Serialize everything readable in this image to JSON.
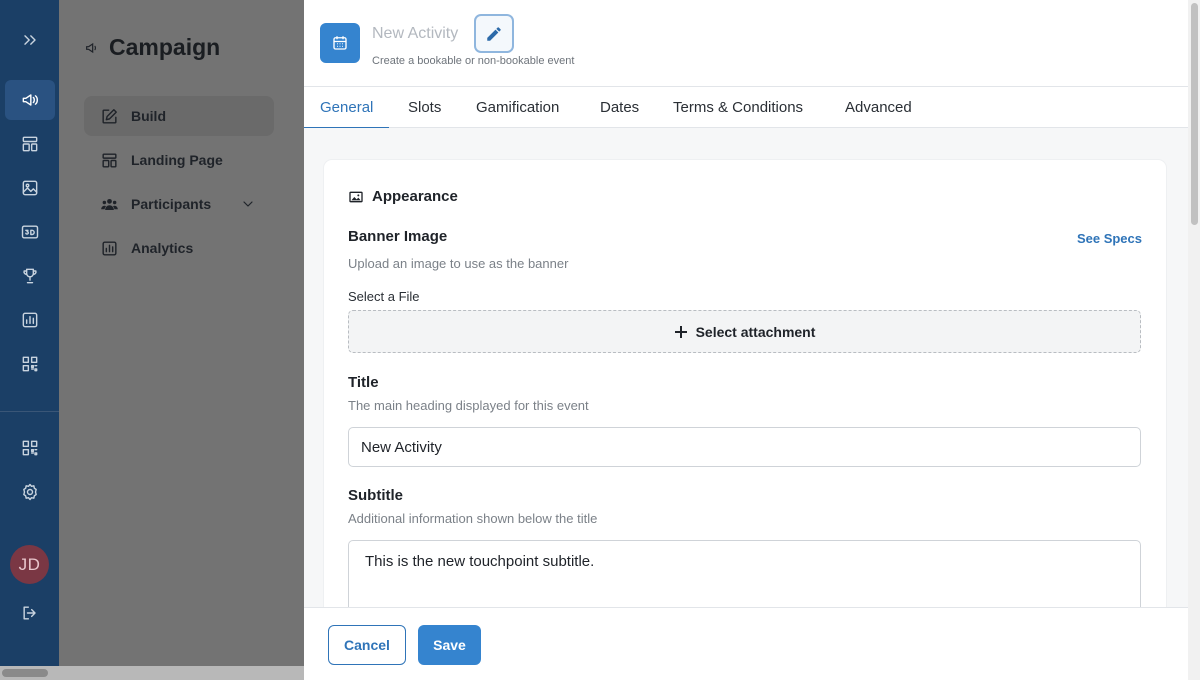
{
  "rail": {
    "avatar_initials": "JD",
    "icons": [
      "expand-icon",
      "megaphone-icon",
      "layout-icon",
      "image-icon",
      "3d-icon",
      "trophy-icon",
      "analytics-icon",
      "qr-icon",
      "qr-icon",
      "settings-icon",
      "logout-icon"
    ]
  },
  "campaign": {
    "title": "Campaign",
    "nav": [
      {
        "label": "Build",
        "icon": "edit-icon"
      },
      {
        "label": "Landing Page",
        "icon": "layout-icon"
      },
      {
        "label": "Participants",
        "icon": "users-icon"
      },
      {
        "label": "Analytics",
        "icon": "chart-icon"
      }
    ]
  },
  "drawer": {
    "title": "New Activity",
    "subtitle": "Create a bookable or non-bookable event",
    "tabs": [
      "General",
      "Slots",
      "Gamification",
      "Dates",
      "Terms & Conditions",
      "Advanced"
    ],
    "active_tab": "General",
    "section_title": "Appearance",
    "banner": {
      "label": "Banner Image",
      "help": "Upload an image to use as the banner",
      "specs_link": "See Specs",
      "select_label": "Select a File",
      "attach_button": "Select attachment"
    },
    "title_field": {
      "label": "Title",
      "help": "The main heading displayed for this event",
      "value": "New Activity"
    },
    "subtitle_field": {
      "label": "Subtitle",
      "help": "Additional information shown below the title",
      "value": "This is the new touchpoint subtitle."
    },
    "footer": {
      "cancel": "Cancel",
      "save": "Save"
    }
  },
  "colors": {
    "rail": "#1b3f66",
    "accent": "#3584cf",
    "link": "#2f74b8",
    "overlay": "#737373"
  }
}
